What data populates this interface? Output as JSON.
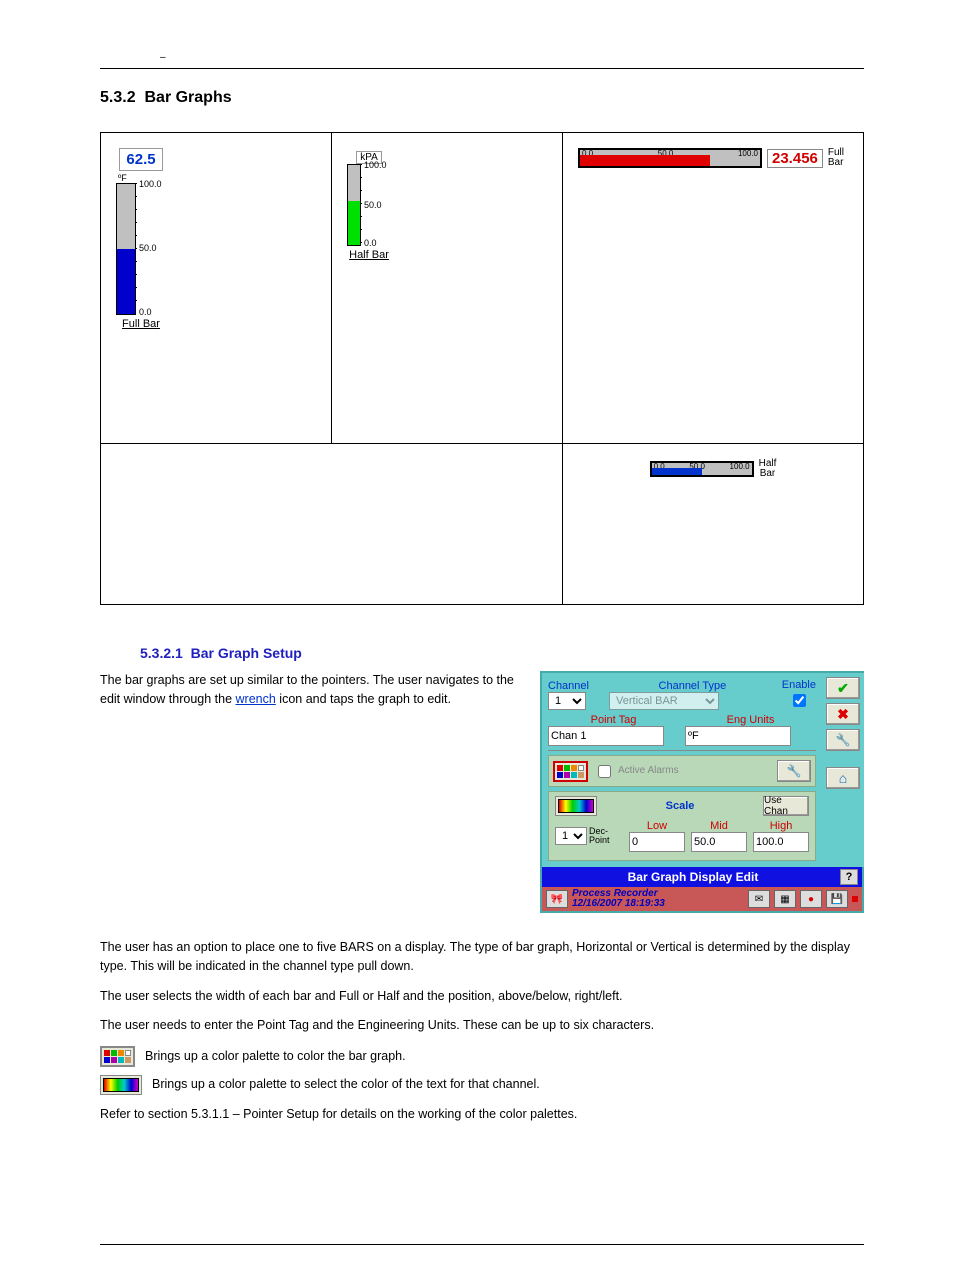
{
  "header": {
    "small_mark": "–"
  },
  "heading": {
    "number": "5.3.2",
    "title": "Bar Graphs"
  },
  "vertical_full": {
    "value": "62.5",
    "unit": "ºF",
    "tick_top": "100.0",
    "tick_mid": "50.0",
    "tick_bot": "0.0",
    "caption": "Full Bar"
  },
  "vertical_half": {
    "unit": "kPA",
    "tick_top": "100.0",
    "tick_mid": "50.0",
    "tick_bot": "0.0",
    "caption": "Half Bar"
  },
  "hbar_full": {
    "ticks": [
      "0.0",
      "50.0",
      "100.0"
    ],
    "value": "23.456",
    "caption_line1": "Full",
    "caption_line2": "Bar"
  },
  "hbar_half": {
    "ticks": [
      "0.0",
      "50.0",
      "100.0"
    ],
    "caption_line1": "Half",
    "caption_line2": "Bar"
  },
  "subheading": {
    "number": "5.3.2.1",
    "title": "Bar Graph Setup"
  },
  "setup_intro": {
    "preamble": "The bar graphs are set up similar to the pointers. The user navigates to the edit window through the ",
    "link": "wrench",
    "after": " icon and taps the graph to edit."
  },
  "dialog": {
    "channel_lbl": "Channel",
    "channel_val": "1",
    "channel_type_lbl": "Channel Type",
    "channel_type_val": "Vertical BAR",
    "enable_lbl": "Enable",
    "enable_checked": true,
    "point_tag_lbl": "Point Tag",
    "point_tag_val": "Chan 1",
    "eng_units_lbl": "Eng Units",
    "eng_units_val": "ºF",
    "active_alarms_lbl": "Active Alarms",
    "scale_lbl": "Scale",
    "use_chan_lbl": "Use Chan",
    "dec_point_lbl": "Dec-Point",
    "dec_point_val": "1",
    "low_lbl": "Low",
    "low_val": "0",
    "mid_lbl": "Mid",
    "mid_val": "50.0",
    "high_lbl": "High",
    "high_val": "100.0",
    "title_bar": "Bar Graph Display Edit",
    "help": "?",
    "status_title": "Process Recorder",
    "status_time": "12/16/2007 18:19:33"
  },
  "para1": "The user has an option to place one to five BARS on a display. The type of bar graph, Horizontal or Vertical is determined by the display type. This will be indicated in the channel type pull down.",
  "para2": "The user selects the width of each bar and Full or Half and the position, above/below, right/left.",
  "para3": "The user needs to enter the Point Tag and the Engineering Units. These can be up to six characters.",
  "icon_desc_1": "Brings up a color palette to color the bar graph.",
  "icon_desc_2": "Brings up a color palette to select the color of the text for that channel.",
  "palette_para_pre": "Refer to section 5.3.1.1 ",
  "palette_em": "–",
  "palette_para_post": " Pointer Setup for details on the working of the color palettes."
}
